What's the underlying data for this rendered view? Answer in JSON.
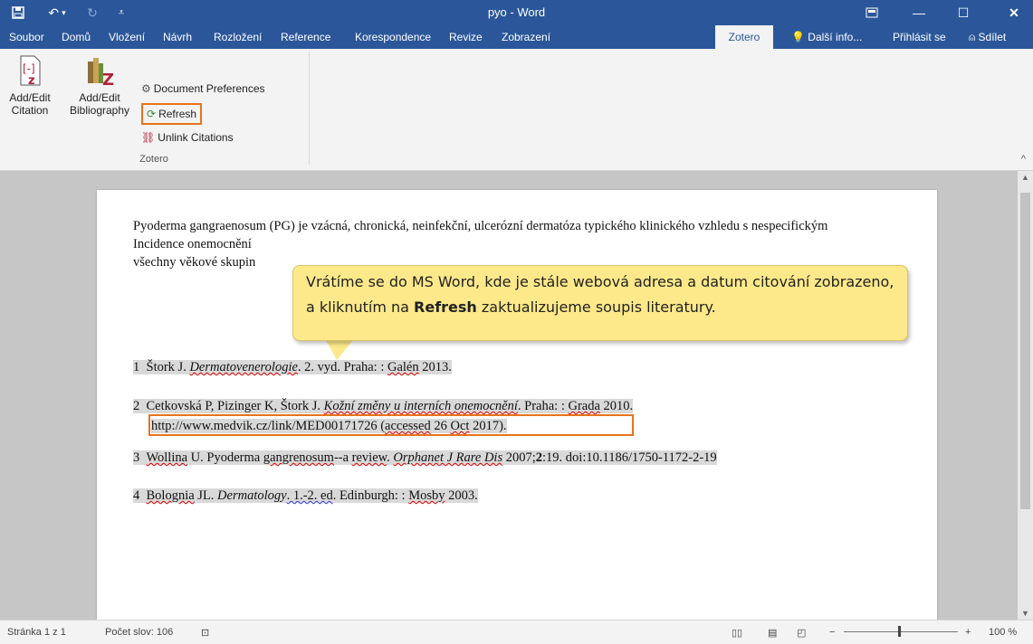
{
  "window": {
    "title": "pyo - Word",
    "buttons": {
      "minimize": "—",
      "maximize": "☐",
      "close": "✕"
    },
    "qat": {
      "save": "💾",
      "undo": "↶",
      "redo": "↻",
      "customize": "="
    }
  },
  "tabs": [
    {
      "label": "Soubor"
    },
    {
      "label": "Domů"
    },
    {
      "label": "Vložení"
    },
    {
      "label": "Návrh"
    },
    {
      "label": "Rozložení"
    },
    {
      "label": "Reference"
    },
    {
      "label": "Korespondence"
    },
    {
      "label": "Revize"
    },
    {
      "label": "Zobrazení"
    },
    {
      "label": "Zotero"
    }
  ],
  "tell_me": "Další info...",
  "sign_in": "Přihlásit se",
  "share": "Sdílet",
  "ribbon": {
    "add_edit_citation": "Add/Edit Citation",
    "add_edit_bibliography": "Add/Edit Bibliography",
    "document_preferences": "Document Preferences",
    "refresh": "Refresh",
    "unlink_citations": "Unlink Citations",
    "group_label": "Zotero"
  },
  "document": {
    "paragraph_visible": "Pyoderma gangraenosum (PG) je vzácná, chronická, neinfekční, ulcerózní dermatóza typického klinického vzhledu s nespecifickým",
    "paragraph_line3": "Incidence onemocnění",
    "paragraph_line4": "všechny věkové skupin",
    "refs": {
      "r1": {
        "num": "1",
        "author": "Štork J. ",
        "title": "Dermatovenerologie",
        "rest": ". 2. vyd. Praha: : ",
        "pub": "Galén",
        "year": " 2013."
      },
      "r2": {
        "num": "2",
        "author": "Cetkovská P, Pizinger K, Štork J. ",
        "title": "Kožní změny u interních onemocnění",
        "rest": ". Praha: : ",
        "pub": "Grada",
        "year": " 2010.",
        "url": "http://www.medvik.cz/link/MED00171726 (",
        "accessed": "accessed",
        "date": " 26 ",
        "oct": "Oct",
        "end": " 2017)."
      },
      "r3": {
        "num": "3",
        "author": "Wollina",
        "rest": " U. Pyoderma ",
        "gangrenosum": "gangrenosum",
        "a": "--a ",
        "review": "review",
        "dot": ". ",
        "journal": "Orphanet J Rare Dis",
        "vol": " 2007;",
        "bold": "2",
        "tail": ":19. doi:10.1186/1750-1172-2-19"
      },
      "r4": {
        "num": "4",
        "author": "Bolognia",
        "rest": " JL. ",
        "title": "Dermatology",
        "ed": ". 1.-2. ed",
        "place": ". Edinburgh: : ",
        "pub": "Mosby",
        "year": " 2003."
      }
    }
  },
  "callout": {
    "text_before": "Vrátíme se do MS Word, kde je stále webová adresa a datum citování zobrazeno, a kliknutím na ",
    "bold": "Refresh",
    "text_after": " zaktualizujeme soupis literatury."
  },
  "status": {
    "page": "Stránka 1 z 1",
    "words": "Počet slov: 106",
    "zoom": "100 %"
  },
  "colors": {
    "brand": "#2b579a",
    "highlight": "#e8731c",
    "callout": "#fde98a"
  }
}
